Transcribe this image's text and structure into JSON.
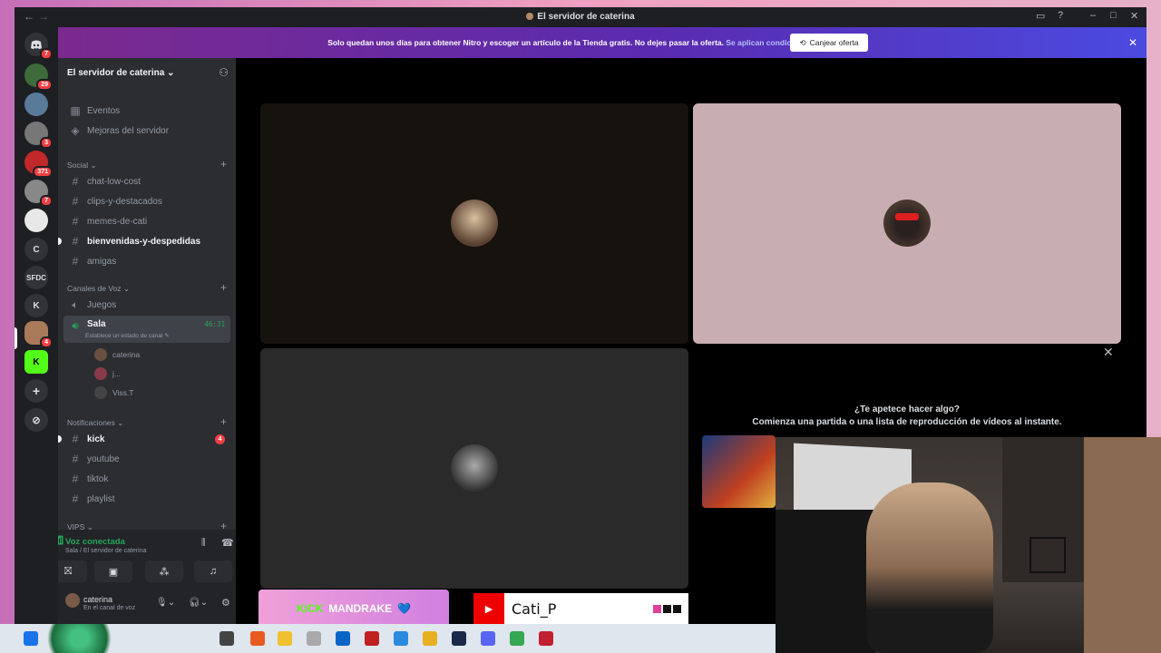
{
  "window": {
    "title": "El servidor de caterina",
    "back": "←",
    "forward": "→"
  },
  "guilds": {
    "badges": [
      "7",
      "29",
      "3",
      "371",
      "7",
      "4"
    ],
    "letters": [
      "C",
      "SFDC",
      "K"
    ],
    "add": "+",
    "explore": "⊘"
  },
  "banner": {
    "text": "Solo quedan unos días para obtener Nitro y escoger un artículo de la Tienda gratis. No dejes pasar la oferta.",
    "link": "Se aplican condiciones.",
    "button": "Canjear oferta",
    "close": "✕"
  },
  "server": {
    "name": "El servidor de caterina",
    "chevron": "⌄",
    "top_items": [
      {
        "label": "Eventos",
        "icon": "calendar-icon"
      },
      {
        "label": "Mejoras del servidor",
        "icon": "boost-icon"
      }
    ],
    "categories": {
      "social": "Social",
      "voice": "Canales de Voz",
      "notifications": "Notificaciones",
      "vips": "VIPS"
    },
    "social_channels": [
      {
        "label": "chat-low-cost",
        "unread": false
      },
      {
        "label": "clips-y-destacados",
        "unread": false
      },
      {
        "label": "memes-de-cati",
        "unread": false
      },
      {
        "label": "bienvenidas-y-despedidas",
        "unread": true
      },
      {
        "label": "amigas",
        "unread": false
      }
    ],
    "voice_channels": {
      "juegos": "Juegos",
      "sala": "Sala",
      "sala_timer": "46:31",
      "sala_status": "Establece un estado de canal",
      "users": [
        "caterina",
        "j...",
        "Viss.T"
      ]
    },
    "notification_channels": [
      {
        "label": "kick",
        "unread": true,
        "badge": "4"
      },
      {
        "label": "youtube",
        "unread": false,
        "badge": ""
      },
      {
        "label": "tiktok",
        "unread": false,
        "badge": ""
      },
      {
        "label": "playlist",
        "unread": false,
        "badge": ""
      }
    ],
    "hash": "#",
    "plus": "+"
  },
  "voice_panel": {
    "title": "Voz conectada",
    "subtitle": "Sala / El servidor de caterina",
    "user": "caterina",
    "user_status": "En el canal de voz"
  },
  "activity": {
    "question": "¿Te apetece hacer algo?",
    "description": "Comienza una partida o una lista de reproducción de vídeos al instante.",
    "close": "✕"
  },
  "overlays": {
    "kick_logo": "KICK",
    "kick_name": "MANDRAKE",
    "kick_heart": "💙",
    "youtube_name": "Cati_P",
    "youtube_play": "▶"
  },
  "colors": {
    "accent": "#5865f2",
    "online": "#23a55a",
    "danger": "#f23f43",
    "tile_pink": "#c8aeb2",
    "tile_dark": "#16120e",
    "tile_gray": "#2a2a2a"
  }
}
